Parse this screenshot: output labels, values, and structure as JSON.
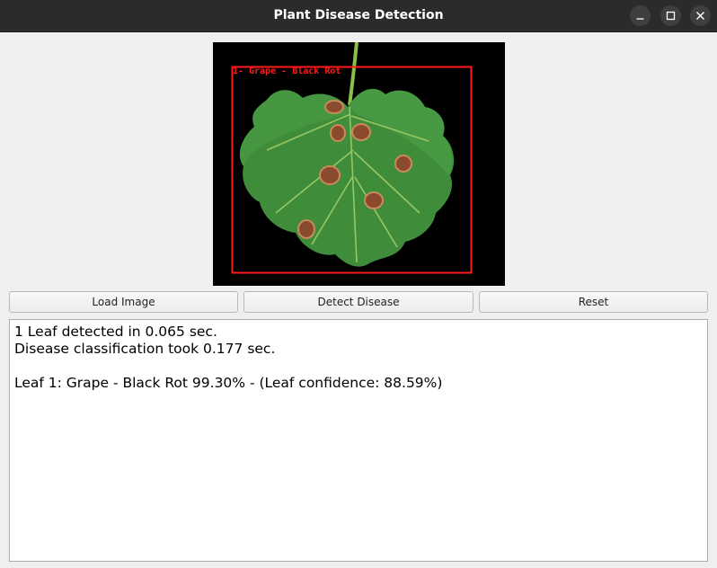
{
  "window": {
    "title": "Plant Disease Detection"
  },
  "detection": {
    "label": "1- Grape - Black Rot"
  },
  "buttons": {
    "load": "Load Image",
    "detect": "Detect Disease",
    "reset": "Reset"
  },
  "output": {
    "line1": "1 Leaf detected in 0.065 sec.",
    "line2": "Disease classification took 0.177 sec.",
    "line3": "",
    "line4": "Leaf 1: Grape - Black Rot 99.30% - (Leaf confidence: 88.59%)"
  }
}
